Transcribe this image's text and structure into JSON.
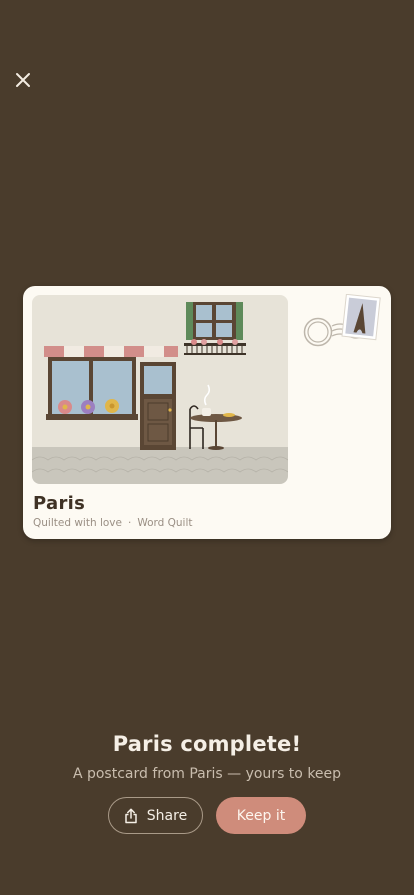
{
  "postcard": {
    "city": "Paris",
    "caption": "Quilted with love",
    "separator": "·",
    "source": "Word Quilt"
  },
  "completion": {
    "title": "Paris complete!",
    "subtitle": "A postcard from Paris — yours to keep"
  },
  "actions": {
    "share_label": "Share",
    "keep_label": "Keep it"
  },
  "icons": {
    "close": "close-icon",
    "share": "share-icon",
    "stamp": "eiffel-tower-stamp-icon",
    "postmark": "postmark-icon"
  },
  "colors": {
    "background": "#4a3c2c",
    "card": "#fdfaf3",
    "accent": "#cf8c7b",
    "title_text": "#3f3225"
  }
}
